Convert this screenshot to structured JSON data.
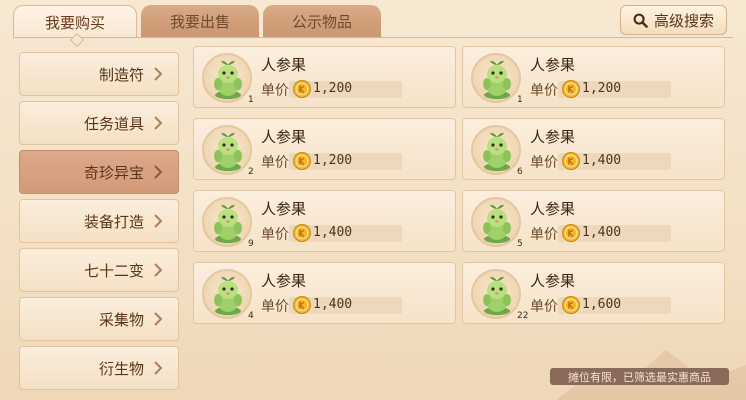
{
  "tabs": [
    {
      "label": "我要购买",
      "active": true
    },
    {
      "label": "我要出售",
      "active": false
    },
    {
      "label": "公示物品",
      "active": false
    }
  ],
  "advanced_search": {
    "label": "高级搜索",
    "icon": "search-icon"
  },
  "sidebar": {
    "items": [
      {
        "label": "制造符"
      },
      {
        "label": "任务道具"
      },
      {
        "label": "奇珍异宝",
        "active": true
      },
      {
        "label": "装备打造"
      },
      {
        "label": "七十二变"
      },
      {
        "label": "采集物"
      },
      {
        "label": "衍生物"
      }
    ]
  },
  "listings": [
    {
      "name": "人参果",
      "price_label": "单价",
      "price": "1,200",
      "qty": "1"
    },
    {
      "name": "人参果",
      "price_label": "单价",
      "price": "1,200",
      "qty": "1"
    },
    {
      "name": "人参果",
      "price_label": "单价",
      "price": "1,200",
      "qty": "2"
    },
    {
      "name": "人参果",
      "price_label": "单价",
      "price": "1,400",
      "qty": "6"
    },
    {
      "name": "人参果",
      "price_label": "单价",
      "price": "1,400",
      "qty": "9"
    },
    {
      "name": "人参果",
      "price_label": "单价",
      "price": "1,400",
      "qty": "5"
    },
    {
      "name": "人参果",
      "price_label": "单价",
      "price": "1,400",
      "qty": "4"
    },
    {
      "name": "人参果",
      "price_label": "单价",
      "price": "1,600",
      "qty": "22"
    }
  ],
  "tip": "摊位有限，已筛选最实惠商品",
  "colors": {
    "accent": "#d29a77",
    "coin": "#f2b52b",
    "tip_bg": "#8a6a58"
  }
}
